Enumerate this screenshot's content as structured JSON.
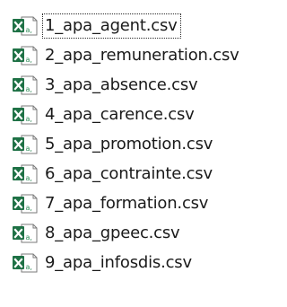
{
  "files": [
    {
      "name": "1_apa_agent.csv",
      "icon": "excel-csv-file-icon",
      "focused": true
    },
    {
      "name": "2_apa_remuneration.csv",
      "icon": "excel-csv-file-icon",
      "focused": false
    },
    {
      "name": "3_apa_absence.csv",
      "icon": "excel-csv-file-icon",
      "focused": false
    },
    {
      "name": "4_apa_carence.csv",
      "icon": "excel-csv-file-icon",
      "focused": false
    },
    {
      "name": "5_apa_promotion.csv",
      "icon": "excel-csv-file-icon",
      "focused": false
    },
    {
      "name": "6_apa_contrainte.csv",
      "icon": "excel-csv-file-icon",
      "focused": false
    },
    {
      "name": "7_apa_formation.csv",
      "icon": "excel-csv-file-icon",
      "focused": false
    },
    {
      "name": "8_apa_gpeec.csv",
      "icon": "excel-csv-file-icon",
      "focused": false
    },
    {
      "name": "9_apa_infosdis.csv",
      "icon": "excel-csv-file-icon",
      "focused": false
    }
  ],
  "colors": {
    "excel_green": "#1e7145",
    "excel_green_light": "#2e8b57",
    "text": "#1a1a1a"
  }
}
